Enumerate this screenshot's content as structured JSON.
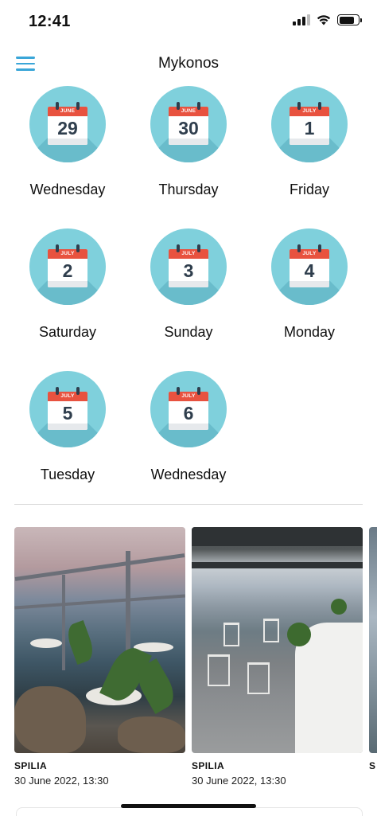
{
  "status_bar": {
    "time": "12:41",
    "signal_bars": 4,
    "signal_bars_filled": 3,
    "battery_level": 0.8,
    "icons": [
      "cellular-signal-icon",
      "wifi-icon",
      "battery-icon"
    ]
  },
  "header": {
    "title": "Mykonos",
    "menu_icon": "hamburger-menu-icon",
    "accent_color": "#3aa6d8"
  },
  "days": [
    {
      "month": "JUNE",
      "day": "29",
      "weekday": "Wednesday"
    },
    {
      "month": "JUNE",
      "day": "30",
      "weekday": "Thursday"
    },
    {
      "month": "JULY",
      "day": "1",
      "weekday": "Friday"
    },
    {
      "month": "JULY",
      "day": "2",
      "weekday": "Saturday"
    },
    {
      "month": "JULY",
      "day": "3",
      "weekday": "Sunday"
    },
    {
      "month": "JULY",
      "day": "4",
      "weekday": "Monday"
    },
    {
      "month": "JULY",
      "day": "5",
      "weekday": "Tuesday"
    },
    {
      "month": "JULY",
      "day": "6",
      "weekday": "Wednesday"
    }
  ],
  "colors": {
    "day_circle": "#7fd0dc",
    "calendar_header": "#e8523f",
    "calendar_number": "#2f3e4d"
  },
  "restaurants": [
    {
      "name": "SPILIA",
      "datetime": "30 June 2022, 13:30"
    },
    {
      "name": "SPILIA",
      "datetime": "30 June 2022, 13:30"
    },
    {
      "name": "S"
    }
  ]
}
